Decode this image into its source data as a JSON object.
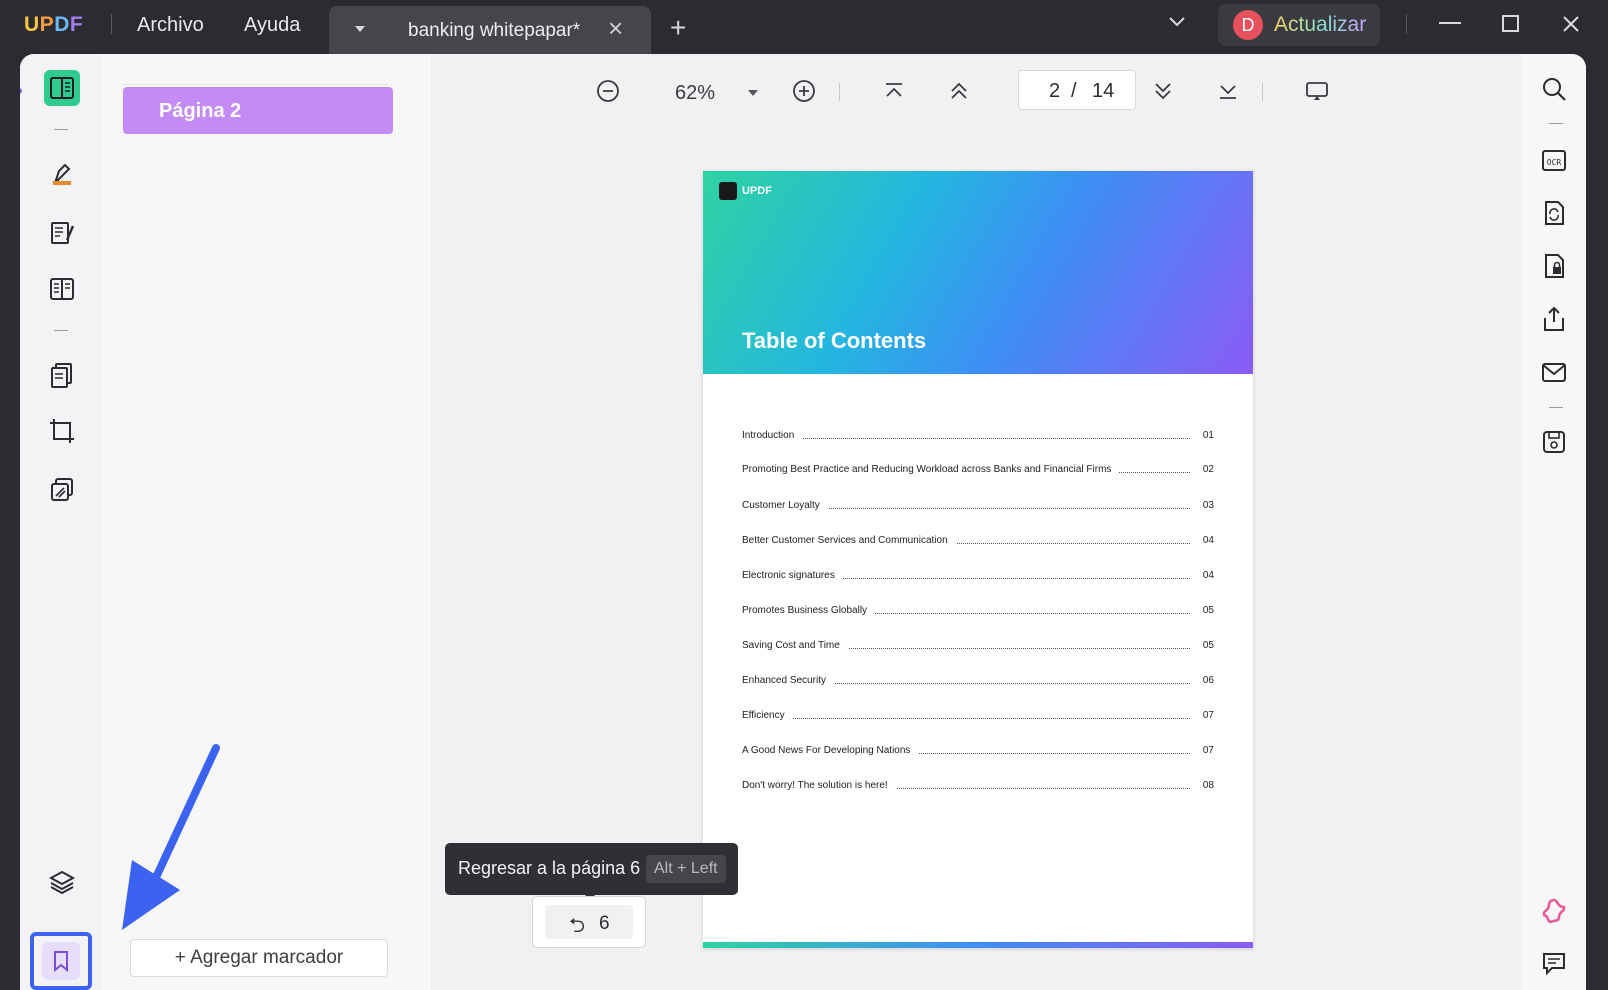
{
  "app": {
    "logo": "UPDF",
    "menus": [
      "Archivo",
      "Ayuda"
    ],
    "tab_title": "banking whitepapar*",
    "upgrade_avatar": "D",
    "upgrade_label": "Actualizar"
  },
  "toolbar": {
    "zoom": "62%",
    "current_page": "2",
    "page_separator": "/",
    "total_pages": "14"
  },
  "bookmarks_panel": {
    "items": [
      {
        "label": "Página 2"
      }
    ],
    "add_label": "+ Agregar marcador"
  },
  "document": {
    "header_brand": "UPDF",
    "title": "Table of Contents",
    "toc": [
      {
        "text": "Introduction",
        "page": "01"
      },
      {
        "text": "Promoting Best Practice and Reducing Workload across Banks and Financial Firms",
        "page": "02"
      },
      {
        "text": "Customer Loyalty",
        "page": "03"
      },
      {
        "text": "Better Customer Services and Communication",
        "page": "04"
      },
      {
        "text": "Electronic signatures",
        "page": "04"
      },
      {
        "text": "Promotes Business Globally",
        "page": "05"
      },
      {
        "text": "Saving Cost and Time",
        "page": "05"
      },
      {
        "text": "Enhanced Security",
        "page": "06"
      },
      {
        "text": "Efficiency",
        "page": "07"
      },
      {
        "text": "A Good News For Developing Nations",
        "page": "07"
      },
      {
        "text": "Don't worry! The solution is here!",
        "page": "08"
      }
    ]
  },
  "tooltip": {
    "text": "Regresar a la página 6",
    "shortcut": "Alt + Left"
  },
  "back_button": {
    "arrow": "⮌",
    "page": "6"
  },
  "colors": {
    "accent": "#8c5cf0",
    "bookmark_item": "#c48bf5",
    "annotation_arrow": "#3b63f0",
    "titlebar": "#2b2c30"
  }
}
